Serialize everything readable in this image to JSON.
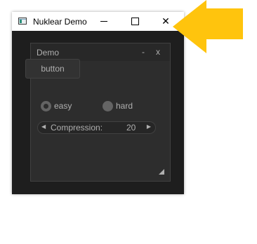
{
  "window": {
    "title": "Nuklear Demo",
    "minimize_glyph": "—",
    "close_glyph": "✕",
    "icon": "app-window-icon"
  },
  "panel": {
    "title": "Demo",
    "minimize_label": "-",
    "close_label": "x",
    "button_label": "button",
    "radio_options": [
      {
        "label": "easy",
        "selected": true
      },
      {
        "label": "hard",
        "selected": false
      }
    ],
    "property": {
      "label": "Compression:",
      "value": "20",
      "decrement_glyph": "◀",
      "increment_glyph": "▶"
    }
  },
  "colors": {
    "window_bg": "#1e1e1e",
    "panel_bg": "#2d2d2d",
    "text": "#afafaf",
    "arrow": "#ffc40d"
  }
}
